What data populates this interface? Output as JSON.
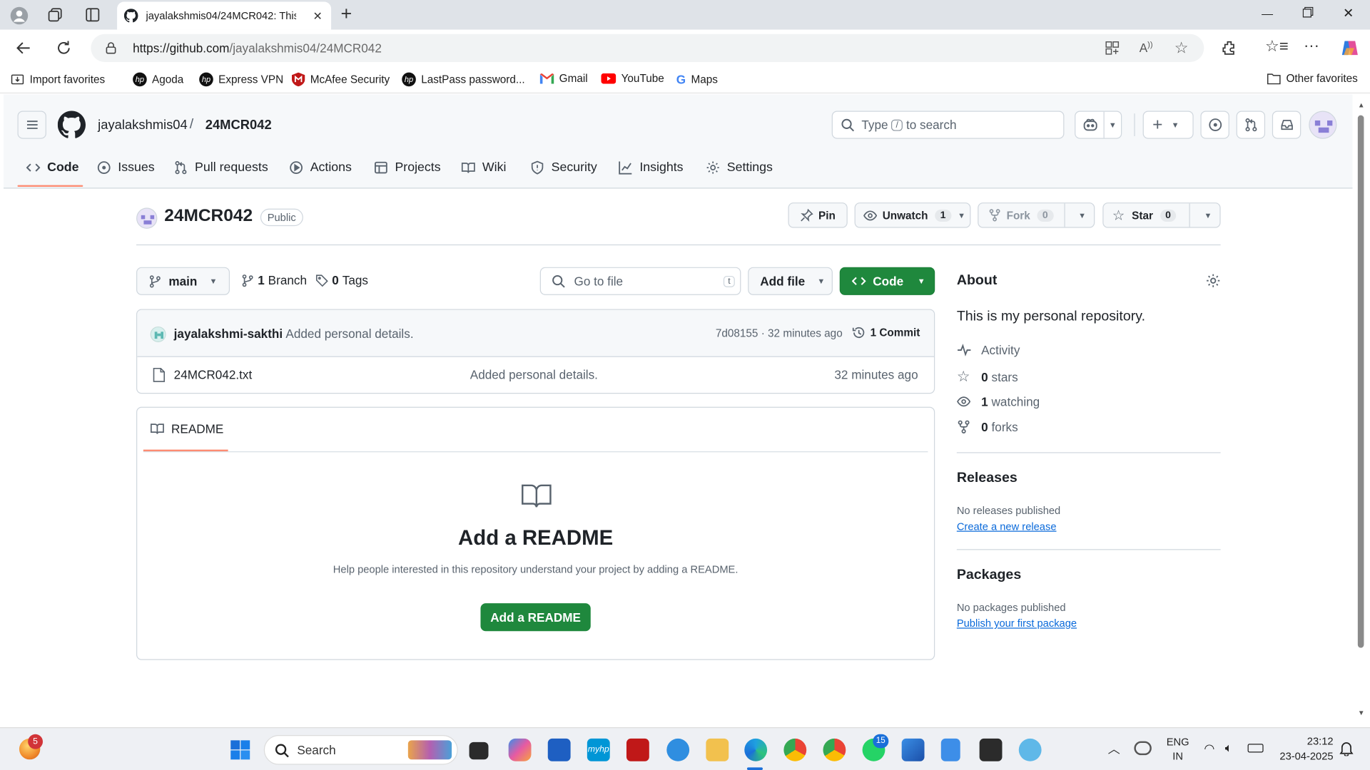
{
  "browser": {
    "tab_title": "jayalakshmis04/24MCR042: This is",
    "url_host": "https://github.com",
    "url_path": "/jayalakshmis04/24MCR042",
    "favorites": [
      "Import favorites",
      "Agoda",
      "Express VPN",
      "McAfee Security",
      "LastPass password...",
      "Gmail",
      "YouTube",
      "Maps"
    ],
    "other_favorites": "Other favorites"
  },
  "header": {
    "owner": "jayalakshmis04",
    "separator": "/",
    "repo": "24MCR042",
    "search_before": "Type",
    "search_key": "/",
    "search_after": "to search"
  },
  "nav": {
    "items": [
      "Code",
      "Issues",
      "Pull requests",
      "Actions",
      "Projects",
      "Wiki",
      "Security",
      "Insights",
      "Settings"
    ]
  },
  "repo": {
    "name": "24MCR042",
    "visibility": "Public",
    "pin": "Pin",
    "unwatch": "Unwatch",
    "watch_count": "1",
    "fork": "Fork",
    "fork_count": "0",
    "star": "Star",
    "star_count": "0"
  },
  "toolbar": {
    "branch": "main",
    "branches_num": "1",
    "branches_label": "Branch",
    "tags_num": "0",
    "tags_label": "Tags",
    "goto_placeholder": "Go to file",
    "goto_key": "t",
    "add_file": "Add file",
    "code": "Code"
  },
  "commit": {
    "author": "jayalakshmi-sakthi",
    "message": "Added personal details.",
    "sha_time": "7d08155 · 32 minutes ago",
    "commits": "1 Commit"
  },
  "files": [
    {
      "name": "24MCR042.txt",
      "message": "Added personal details.",
      "time": "32 minutes ago"
    }
  ],
  "readme": {
    "tab": "README",
    "title": "Add a README",
    "desc": "Help people interested in this repository understand your project by adding a README.",
    "button": "Add a README"
  },
  "about": {
    "title": "About",
    "description": "This is my personal repository.",
    "activity": "Activity",
    "stars_num": "0",
    "stars_label": "stars",
    "watching_num": "1",
    "watching_label": "watching",
    "forks_num": "0",
    "forks_label": "forks"
  },
  "releases": {
    "title": "Releases",
    "none": "No releases published",
    "link": "Create a new release"
  },
  "packages": {
    "title": "Packages",
    "none": "No packages published",
    "link": "Publish your first package"
  },
  "taskbar": {
    "search": "Search",
    "badge_left": "5",
    "badge_whatsapp": "15",
    "lang1": "ENG",
    "lang2": "IN",
    "time": "23:12",
    "date": "23-04-2025"
  },
  "colors": {
    "accent_green": "#1f883d",
    "link_blue": "#0969da",
    "active_tab_underline": "#fd8c73"
  }
}
